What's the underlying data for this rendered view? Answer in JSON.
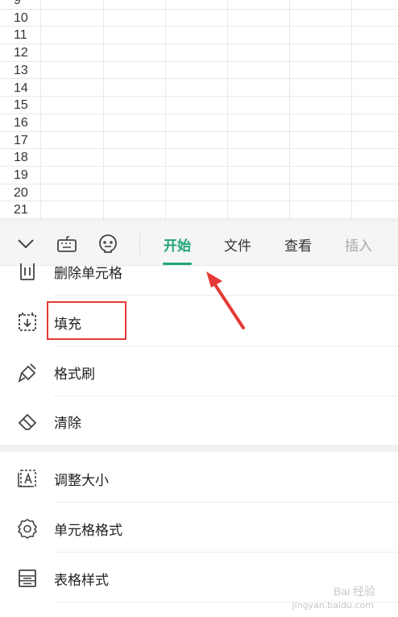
{
  "sheet": {
    "row_numbers": [
      "9",
      "10",
      "11",
      "12",
      "13",
      "14",
      "15",
      "16",
      "17",
      "18",
      "19",
      "20",
      "21"
    ]
  },
  "toolbar": {
    "icons": [
      "chevron-down-icon",
      "keyboard-icon",
      "emoji-icon"
    ],
    "tabs": [
      {
        "label": "开始",
        "state": "active"
      },
      {
        "label": "文件",
        "state": "normal"
      },
      {
        "label": "查看",
        "state": "normal"
      },
      {
        "label": "插入",
        "state": "faded"
      }
    ],
    "accent_color": "#1da57a"
  },
  "menu": {
    "items": [
      {
        "label": "删除单元格",
        "icon": "trash-icon"
      },
      {
        "label": "填充",
        "icon": "fill-down-icon"
      },
      {
        "label": "格式刷",
        "icon": "format-brush-icon"
      },
      {
        "label": "清除",
        "icon": "eraser-icon"
      },
      {
        "label": "调整大小",
        "icon": "resize-icon"
      },
      {
        "label": "单元格格式",
        "icon": "gear-icon"
      },
      {
        "label": "表格样式",
        "icon": "table-style-icon"
      }
    ]
  },
  "annotation": {
    "highlight_color": "#e53935"
  },
  "watermark": {
    "text": "Bai 经验",
    "sub": "jingyan.baidu.com"
  }
}
